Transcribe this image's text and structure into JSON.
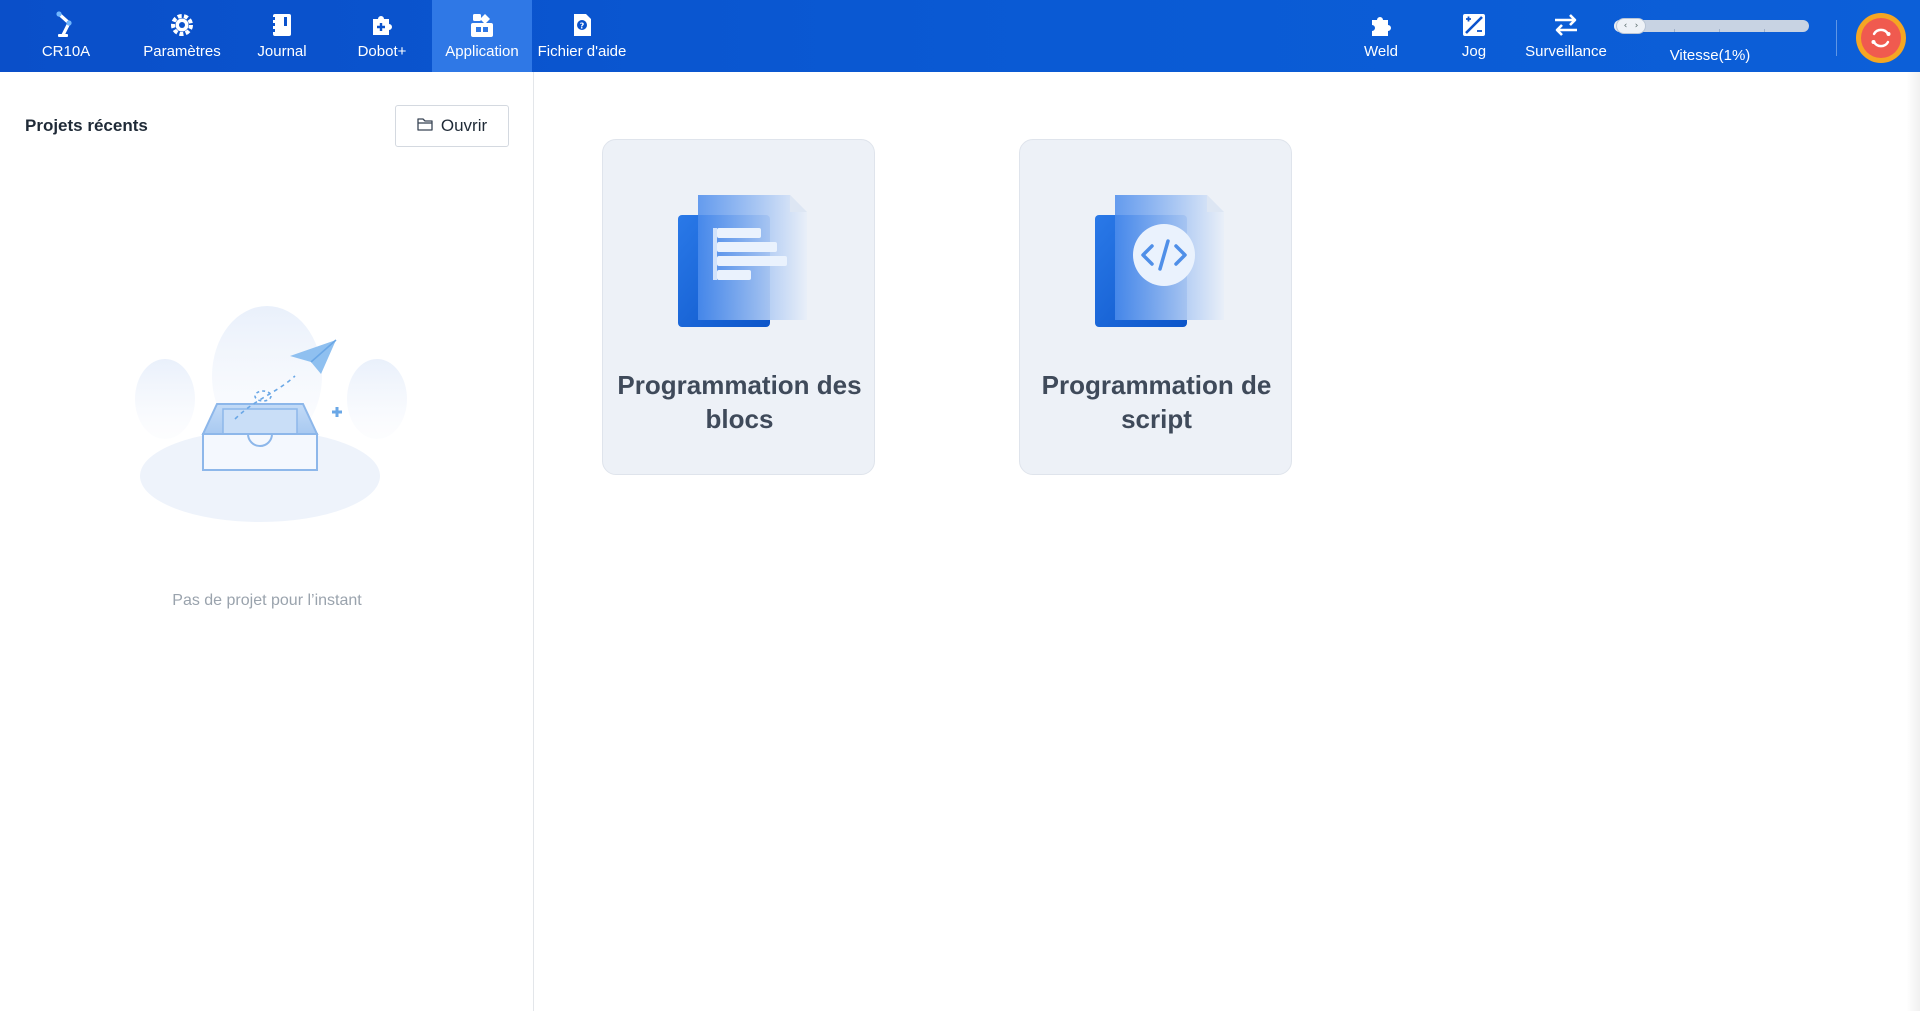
{
  "topbar": {
    "nav_left": [
      {
        "key": "cr10a",
        "label": "CR10A",
        "icon": "robot-arm-icon"
      },
      {
        "key": "params",
        "label": "Paramètres",
        "icon": "gear-icon"
      },
      {
        "key": "journal",
        "label": "Journal",
        "icon": "notebook-icon"
      },
      {
        "key": "dobot",
        "label": "Dobot+",
        "icon": "puzzle-plus-icon"
      },
      {
        "key": "application",
        "label": "Application",
        "icon": "apps-icon",
        "active": true
      },
      {
        "key": "help",
        "label": "Fichier d'aide",
        "icon": "help-file-icon"
      }
    ],
    "nav_right": {
      "weld": "Weld",
      "jog": "Jog",
      "surveillance": "Surveillance"
    },
    "speed": {
      "label": "Vitesse(1%)",
      "value_percent": 1,
      "thumb_glyph": "‹ ›"
    },
    "accent_color": "#0a5ad4",
    "active_tab_color": "#2f78e6"
  },
  "left_panel": {
    "title": "Projets récents",
    "open_button": "Ouvrir",
    "empty_text": "Pas de projet pour l’instant"
  },
  "cards": [
    {
      "key": "blocks",
      "title": "Programmation des blocs",
      "icon": "block-document-icon"
    },
    {
      "key": "script",
      "title": "Programmation de script",
      "icon": "code-document-icon"
    }
  ]
}
